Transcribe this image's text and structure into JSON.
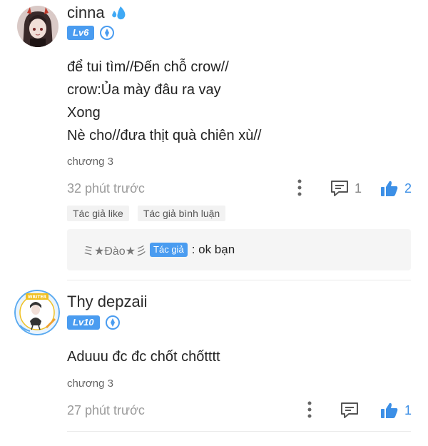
{
  "comments": [
    {
      "username": "cinna",
      "level": "Lv6",
      "lines": [
        "để tui tìm//Đến chỗ crow//",
        "crow:Ủa mày đâu ra vay",
        "Xong",
        "Nè cho//đưa thịt quà chiên xù//"
      ],
      "chapter": "chương 3",
      "time": "32 phút trước",
      "reply_count": "1",
      "like_count": "2",
      "tags": [
        "Tác giả like",
        "Tác giả bình luận"
      ],
      "reply": {
        "name": "ミ★Đào★彡",
        "badge": "Tác giả",
        "text": ": ok bạn"
      }
    },
    {
      "username": "Thy depzaii",
      "level": "Lv10",
      "lines": [
        "Aduuu đc đc chốt chốtttt"
      ],
      "chapter": "chương 3",
      "time": "27 phút trước",
      "like_count": "1",
      "avatar_label": "WRITER"
    }
  ],
  "colors": {
    "accent": "#4a9cf0",
    "like": "#3c8fe6",
    "meta": "#999999"
  }
}
